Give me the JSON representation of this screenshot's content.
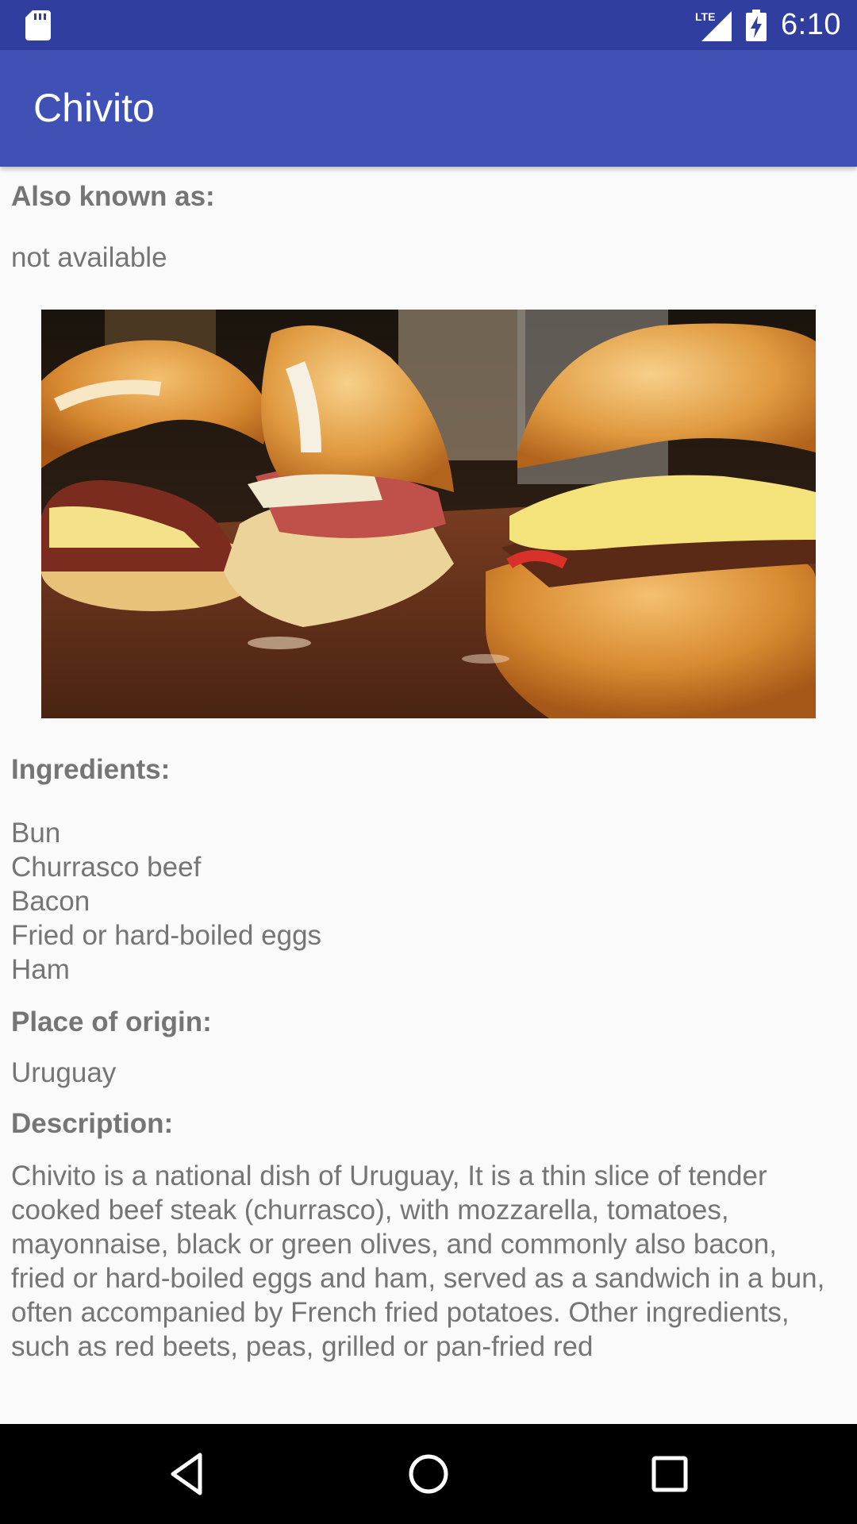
{
  "status_bar": {
    "time": "6:10",
    "network": "LTE",
    "icons": [
      "sd-card-icon",
      "signal-lte-icon",
      "battery-charging-icon"
    ]
  },
  "app_bar": {
    "title": "Chivito"
  },
  "content": {
    "aka_label": "Also known as:",
    "aka_value": "not available",
    "image_alt": "Chivito sandwiches photo",
    "ingredients_label": "Ingredients:",
    "ingredients": [
      "Bun",
      "Churrasco beef",
      "Bacon",
      "Fried or hard-boiled eggs",
      "Ham"
    ],
    "origin_label": "Place of origin:",
    "origin_value": "Uruguay",
    "description_label": "Description:",
    "description": "Chivito is a national dish of Uruguay, It is a thin slice of tender cooked beef steak (churrasco), with mozzarella, tomatoes, mayonnaise, black or green olives, and commonly also bacon, fried or hard-boiled eggs and ham, served as a sandwich in a bun, often accompanied by French fried potatoes. Other ingredients, such as red beets, peas, grilled or pan-fried red"
  },
  "nav_bar": {
    "buttons": [
      "back-icon",
      "home-icon",
      "recents-icon"
    ]
  },
  "colors": {
    "status_bar": "#303f9f",
    "app_bar": "#3f51b5",
    "background": "#fafafa",
    "text": "#757575",
    "nav_bar": "#000000"
  }
}
